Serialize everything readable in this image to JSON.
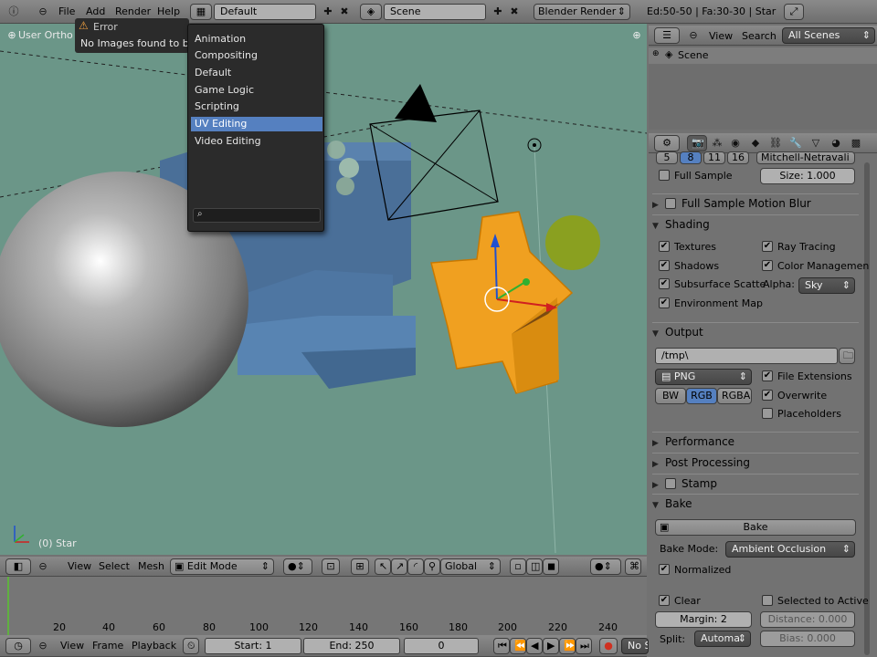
{
  "top_header": {
    "menus": [
      "File",
      "Add",
      "Render",
      "Help"
    ],
    "screen_layout": "Default",
    "scene": "Scene",
    "render_engine": "Blender Render",
    "stats": "Ed:50-50 | Fa:30-30 | Star"
  },
  "error_popup": {
    "title": "Error",
    "message": "No Images found to bake to"
  },
  "layout_dropdown": {
    "items": [
      "Animation",
      "Compositing",
      "Default",
      "Game Logic",
      "Scripting",
      "UV Editing",
      "Video Editing"
    ],
    "selected": "UV Editing",
    "search_placeholder": ""
  },
  "viewport": {
    "view_label": "User Ortho",
    "object_label": "(0) Star"
  },
  "viewport_header": {
    "view": "View",
    "select": "Select",
    "mesh": "Mesh",
    "mode": "Edit Mode",
    "orientation": "Global"
  },
  "timeline": {
    "ticks": [
      "20",
      "40",
      "60",
      "80",
      "100",
      "120",
      "140",
      "160",
      "180",
      "200",
      "220",
      "240"
    ],
    "view": "View",
    "frame": "Frame",
    "playback": "Playback",
    "start": "Start: 1",
    "end": "End: 250",
    "current": "0",
    "sync": "No S"
  },
  "outliner": {
    "view": "View",
    "search": "Search",
    "filter": "All Scenes",
    "item": "Scene"
  },
  "properties": {
    "samples": [
      "5",
      "8",
      "11",
      "16"
    ],
    "filter_type": "Mitchell-Netravali",
    "full_sample": "Full Sample",
    "size": "Size: 1.000",
    "full_sample_motion_blur": "Full Sample Motion Blur",
    "shading": {
      "title": "Shading",
      "textures": "Textures",
      "ray_tracing": "Ray Tracing",
      "shadows": "Shadows",
      "color_management": "Color Managemen",
      "subsurface": "Subsurface Scatte",
      "alpha_label": "Alpha:",
      "alpha_value": "Sky",
      "environment_map": "Environment Map"
    },
    "output": {
      "title": "Output",
      "path": "/tmp\\",
      "format": "PNG",
      "file_extensions": "File Extensions",
      "overwrite": "Overwrite",
      "placeholders": "Placeholders",
      "bw": "BW",
      "rgb": "RGB",
      "rgba": "RGBA"
    },
    "performance": "Performance",
    "post_processing": "Post Processing",
    "stamp": "Stamp",
    "bake": {
      "title": "Bake",
      "button": "Bake",
      "mode_label": "Bake Mode:",
      "mode_value": "Ambient Occlusion",
      "normalized": "Normalized",
      "clear": "Clear",
      "selected_to_active": "Selected to Active",
      "margin": "Margin: 2",
      "distance": "Distance: 0.000",
      "split_label": "Split:",
      "split_value": "Automa",
      "bias": "Bias: 0.000"
    }
  },
  "colors": {
    "viewport_bg": "#6b9688",
    "selection_orange": "#f0a020",
    "active_blue": "#5580c0"
  }
}
